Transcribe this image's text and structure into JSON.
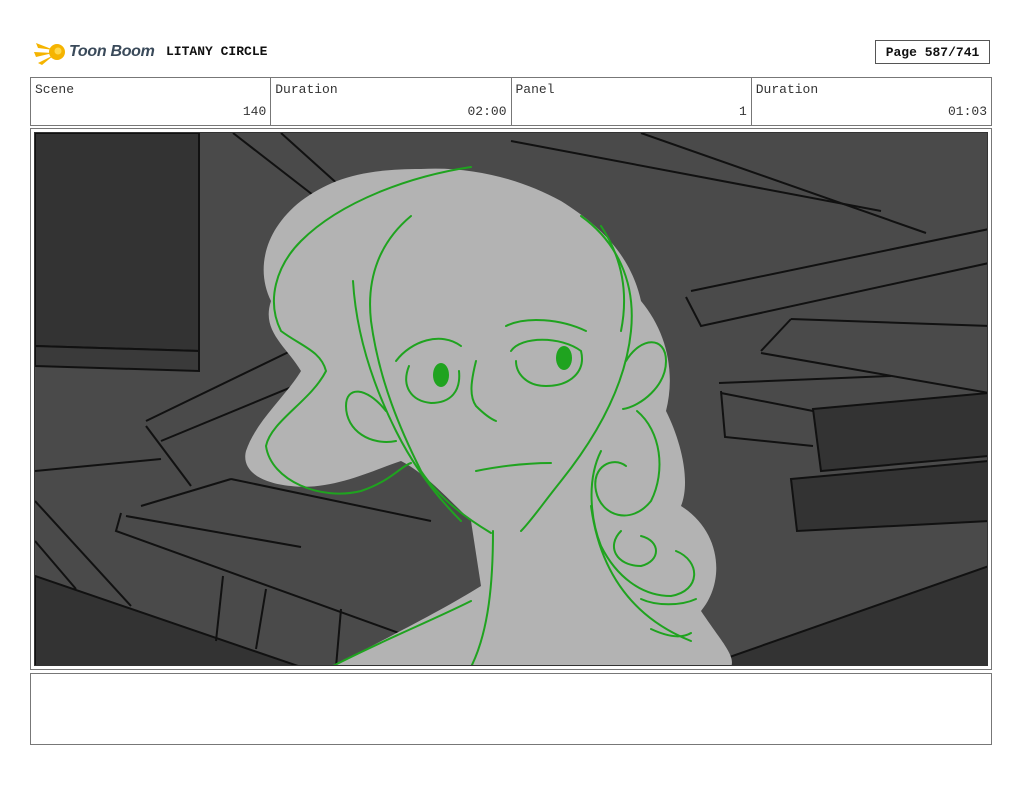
{
  "header": {
    "logo_text": "Toon Boom",
    "project_title": "LITANY CIRCLE",
    "page_label": "Page 587/741"
  },
  "info": {
    "scene_label": "Scene",
    "scene_value": "140",
    "duration1_label": "Duration",
    "duration1_value": "02:00",
    "panel_label": "Panel",
    "panel_value": "1",
    "duration2_label": "Duration",
    "duration2_value": "01:03"
  },
  "notes": {
    "text": ""
  },
  "colors": {
    "sketch_green": "#1fa31f",
    "figure_fill": "#b3b3b3",
    "background_dark": "#4a4a4a",
    "logo_orange": "#f5b400"
  }
}
